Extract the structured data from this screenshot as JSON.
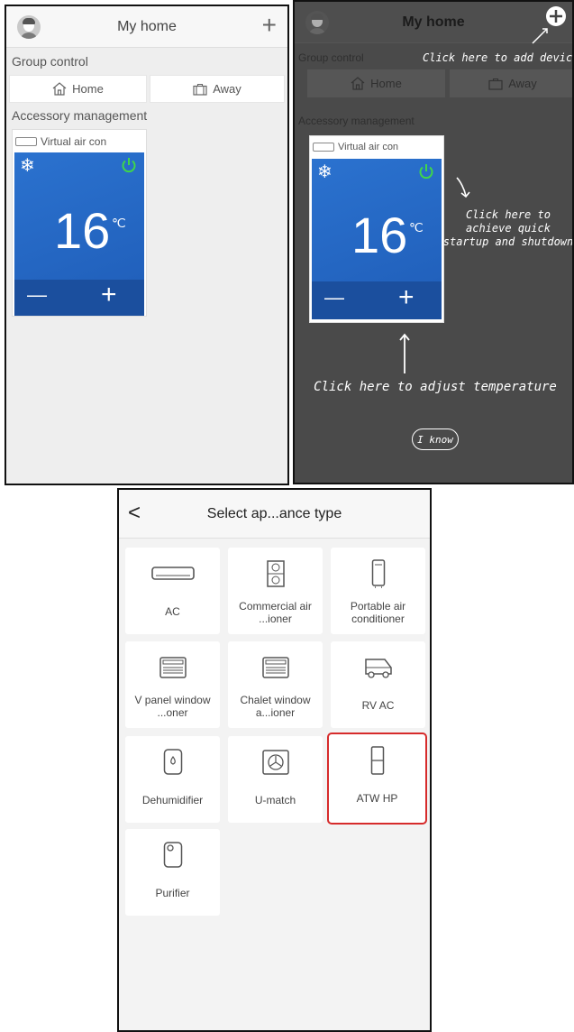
{
  "panel_a": {
    "header": {
      "title": "My home",
      "add_glyph": "+"
    },
    "group_control": {
      "title": "Group control",
      "home": "Home",
      "away": "Away"
    },
    "accessory": {
      "title": "Accessory management",
      "device_name": "Virtual air con",
      "temperature": "16",
      "unit": "℃",
      "minus": "—",
      "plus": "+"
    }
  },
  "panel_b": {
    "header": {
      "title": "My home"
    },
    "group_control": {
      "title": "Group control",
      "home": "Home",
      "away": "Away"
    },
    "accessory": {
      "title": "Accessory management",
      "device_name": "Virtual air con",
      "temperature": "16",
      "unit": "℃",
      "minus": "—",
      "plus": "+"
    },
    "hints": {
      "add_device": "Click here to add device",
      "startup": "Click here to achieve quick startup and shutdown",
      "adjust": "Click here to adjust temperature"
    },
    "dismiss": "I know"
  },
  "panel_c": {
    "header": {
      "title": "Select ap...ance type",
      "back": "<"
    },
    "devices": [
      {
        "label": "AC",
        "icon": "ac-icon"
      },
      {
        "label": "Commercial air ...ioner",
        "icon": "commercial-ac-icon"
      },
      {
        "label": "Portable air conditioner",
        "icon": "portable-ac-icon"
      },
      {
        "label": "V panel window ...oner",
        "icon": "window-ac-icon"
      },
      {
        "label": "Chalet window a...ioner",
        "icon": "window-ac-icon"
      },
      {
        "label": "RV AC",
        "icon": "rv-icon"
      },
      {
        "label": "Dehumidifier",
        "icon": "dehumidifier-icon"
      },
      {
        "label": "U-match",
        "icon": "u-match-icon"
      },
      {
        "label": "ATW HP",
        "icon": "heat-pump-icon"
      },
      {
        "label": "Purifier",
        "icon": "purifier-icon"
      }
    ],
    "selected": "ATW HP"
  },
  "colors": {
    "tile_blue": "#2066c4",
    "power_green": "#3fd64a",
    "highlight_red": "#d62b2b"
  }
}
